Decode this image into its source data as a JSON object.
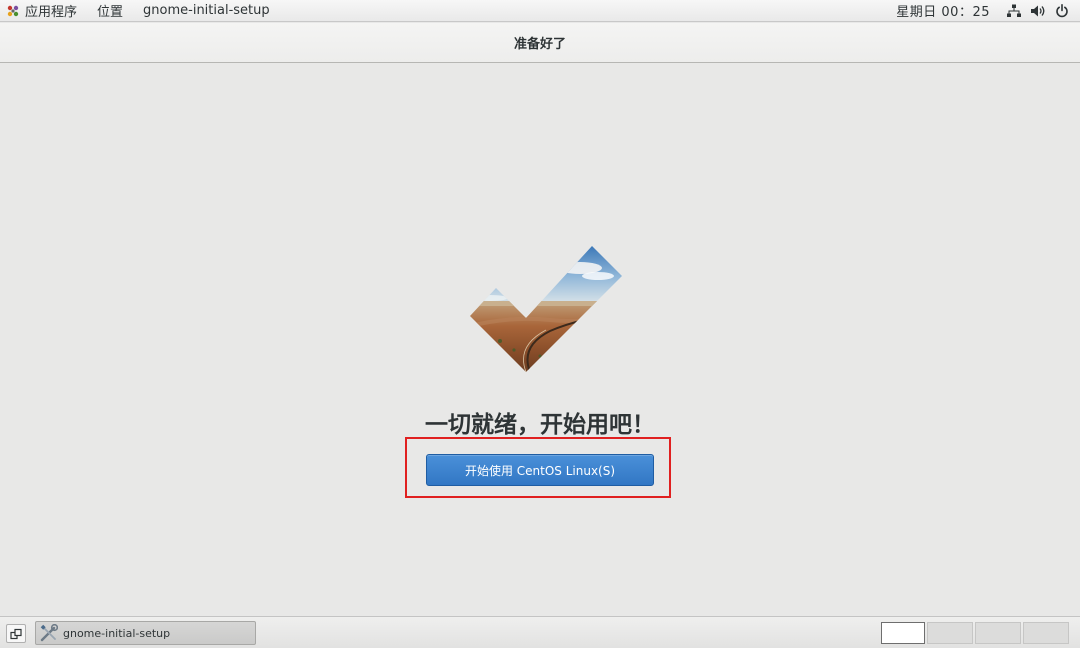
{
  "top_panel": {
    "apps_label": "应用程序",
    "places_label": "位置",
    "window_label": "gnome-initial-setup",
    "clock": "星期日 00：25",
    "icons": [
      "network-icon",
      "volume-icon",
      "power-icon"
    ]
  },
  "header": {
    "title": "准备好了"
  },
  "main": {
    "heading": "一切就绪，开始用吧！",
    "start_button_label": "开始使用 CentOS Linux(S)"
  },
  "bottom_panel": {
    "task_label": "gnome-initial-setup",
    "workspaces": 4,
    "active_workspace": 1
  },
  "colors": {
    "accent": "#3a82d0",
    "highlight": "#e02020",
    "background": "#e8e8e7"
  }
}
